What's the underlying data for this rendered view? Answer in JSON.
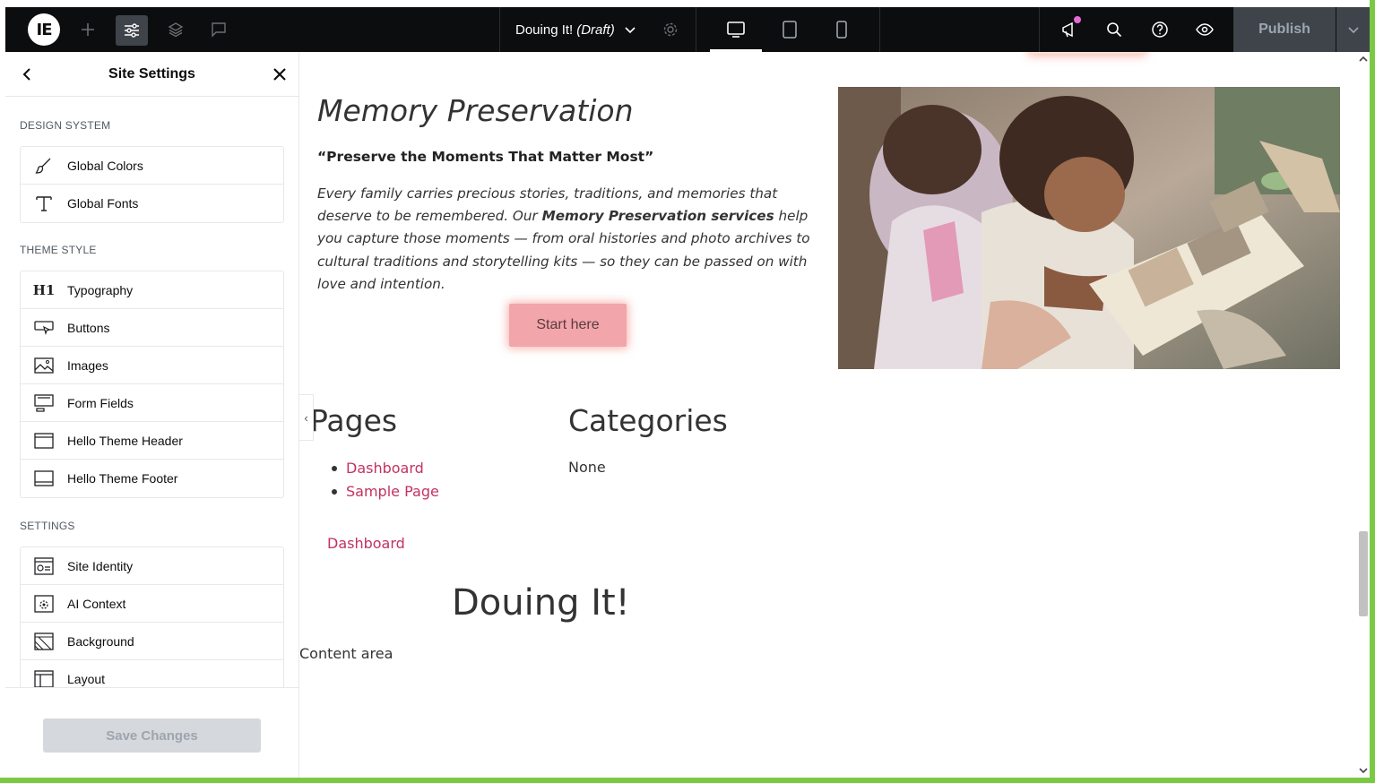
{
  "topbar": {
    "logo_text": "IE",
    "add_icon": "plus-icon",
    "document_title": "Douing It!",
    "document_status": "(Draft)",
    "publish_label": "Publish"
  },
  "panel": {
    "title": "Site Settings",
    "groups": [
      {
        "title": "DESIGN SYSTEM",
        "items": [
          {
            "label": "Global Colors",
            "icon": "brush-icon"
          },
          {
            "label": "Global Fonts",
            "icon": "font-icon"
          }
        ]
      },
      {
        "title": "THEME STYLE",
        "items": [
          {
            "label": "Typography",
            "icon": "heading-icon"
          },
          {
            "label": "Buttons",
            "icon": "button-icon"
          },
          {
            "label": "Images",
            "icon": "image-icon"
          },
          {
            "label": "Form Fields",
            "icon": "form-fields-icon"
          },
          {
            "label": "Hello Theme Header",
            "icon": "header-icon"
          },
          {
            "label": "Hello Theme Footer",
            "icon": "footer-icon"
          }
        ]
      },
      {
        "title": "SETTINGS",
        "items": [
          {
            "label": "Site Identity",
            "icon": "site-identity-icon"
          },
          {
            "label": "AI Context",
            "icon": "ai-context-icon"
          },
          {
            "label": "Background",
            "icon": "background-icon"
          },
          {
            "label": "Layout",
            "icon": "layout-icon"
          }
        ]
      }
    ],
    "save_label": "Save Changes"
  },
  "canvas": {
    "mp_heading": "Memory Preservation",
    "mp_quote": "“Preserve the Moments That Matter Most”",
    "mp_body_1": "Every family carries precious stories, traditions, and memories that deserve to be remembered. Our ",
    "mp_body_bold": "Memory Preservation services",
    "mp_body_2": " help you capture those moments — from oral histories and photo archives to cultural traditions and storytelling kits — so they can be passed on with love and intention.",
    "start_label": "Start here",
    "pages_heading": "Pages",
    "pages": [
      "Dashboard",
      "Sample Page"
    ],
    "categories_heading": "Categories",
    "categories_value": "None",
    "dashboard_link": "Dashboard",
    "site_title": "Douing It!",
    "content_area": "Content area",
    "collapse_glyph": "‹"
  },
  "colors": {
    "topbar_bg": "#0c0d0e",
    "link": "#c3325f",
    "button_pink": "#f2a5aa",
    "frame_green": "#7ac943"
  }
}
